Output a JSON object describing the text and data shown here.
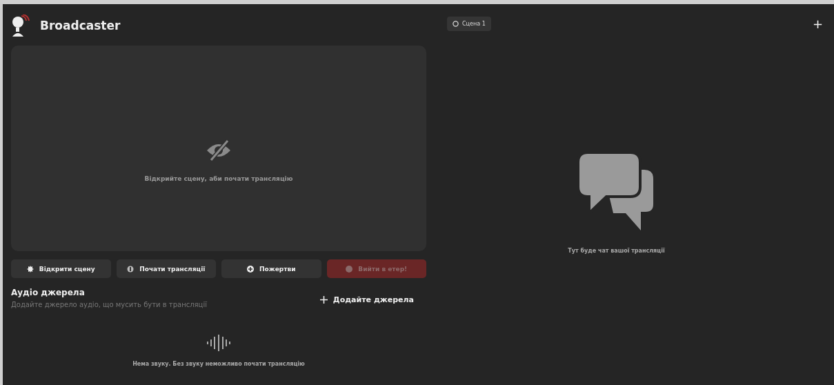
{
  "app": {
    "title": "Broadcaster"
  },
  "preview": {
    "message": "Відкрийте сцену, аби почати трансляцію"
  },
  "actions": [
    {
      "label": "Відкрити сцену",
      "kind": "scene",
      "disabled": false
    },
    {
      "label": "Почати трансляції",
      "kind": "stream",
      "disabled": false
    },
    {
      "label": "Пожертви",
      "kind": "donate",
      "disabled": false
    },
    {
      "label": "Вийти в етер!",
      "kind": "live",
      "disabled": true
    }
  ],
  "audio": {
    "title": "Аудіо джерела",
    "subtitle": "Додайте джерело аудіо, що мусить бути в трансляції",
    "add_button": "Додайте джерела",
    "empty_message": "Нема звуку. Без звуку неможливо почати трансляцію"
  },
  "scene_tab": {
    "label": "Сцена 1"
  },
  "add_scene": {
    "label": "+"
  },
  "chat": {
    "empty_message": "Тут буде чат вашої трансляції"
  }
}
